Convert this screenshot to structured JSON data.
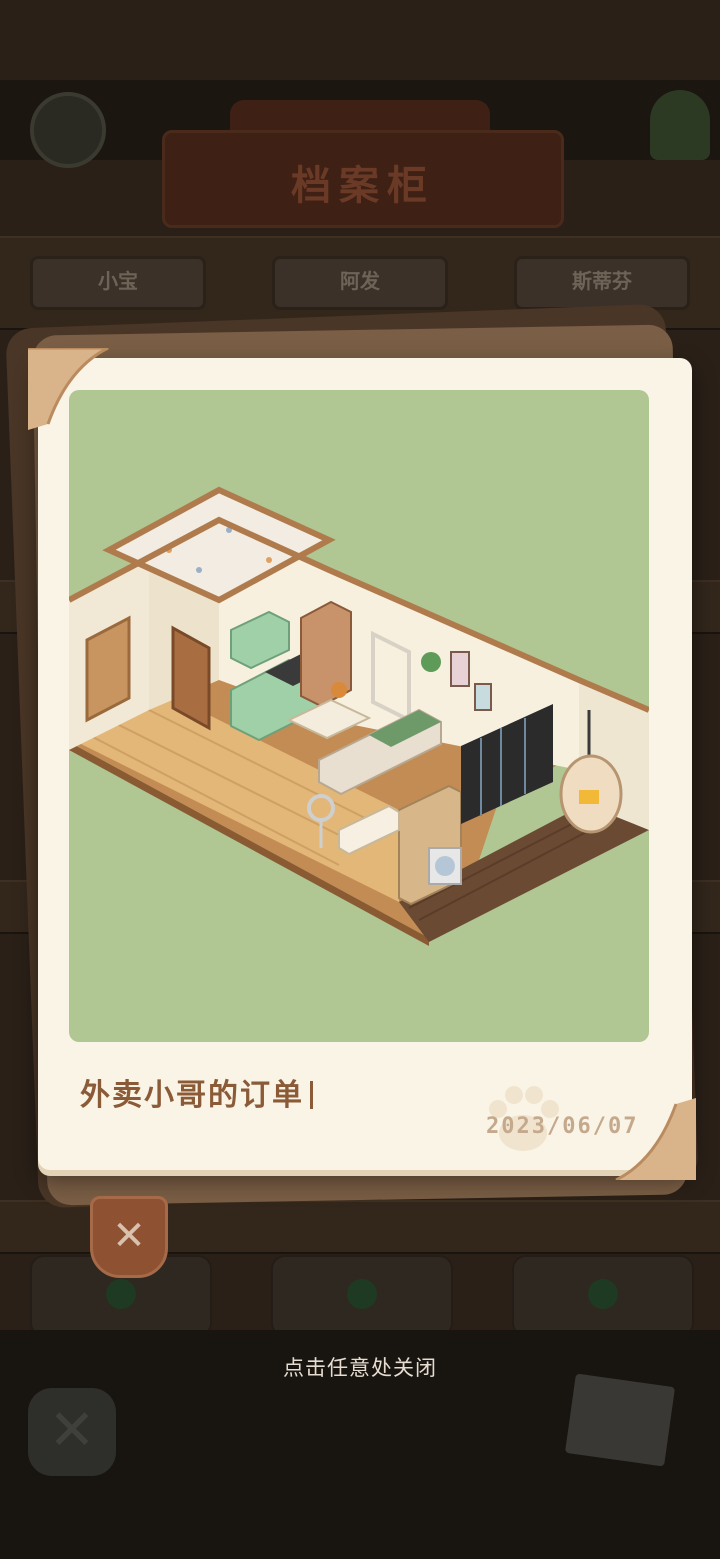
{
  "background": {
    "title": "档案柜",
    "tabs": [
      "小宝",
      "阿发",
      "斯蒂芬"
    ]
  },
  "photo_card": {
    "caption": "外卖小哥的订单",
    "date": "2023/06/07",
    "image": "isometric-room-illustration"
  },
  "close_icon_label": "✕",
  "hint": "点击任意处关闭",
  "colors": {
    "card_bg": "#faf4e6",
    "photo_bg": "#b0c793",
    "caption": "#8b5a37",
    "date": "#c4a98d",
    "close_button": "#8e5233"
  }
}
